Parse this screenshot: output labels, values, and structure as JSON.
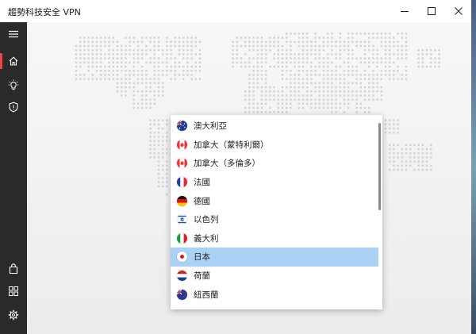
{
  "window": {
    "title": "趨勢科技安全 VPN",
    "controls": [
      "minimize",
      "maximize",
      "close"
    ]
  },
  "sidebar": {
    "top": [
      {
        "name": "menu",
        "icon": "hamburger-menu-icon"
      },
      {
        "name": "home",
        "icon": "home-icon",
        "active": true
      },
      {
        "name": "tips",
        "icon": "lightbulb-icon"
      },
      {
        "name": "security",
        "icon": "shield-icon"
      }
    ],
    "bottom": [
      {
        "name": "shop",
        "icon": "shopping-bag-icon"
      },
      {
        "name": "apps",
        "icon": "apps-grid-icon"
      },
      {
        "name": "settings",
        "icon": "gear-icon"
      }
    ],
    "accent_color": "#e94848"
  },
  "location_dropdown": {
    "selected": "日本",
    "highlight_color": "#a9d2f5",
    "items": [
      {
        "label": "澳大利亞",
        "flag": "australia"
      },
      {
        "label": "加拿大（蒙特利爾）",
        "flag": "canada"
      },
      {
        "label": "加拿大（多倫多）",
        "flag": "canada"
      },
      {
        "label": "法國",
        "flag": "france"
      },
      {
        "label": "德國",
        "flag": "germany"
      },
      {
        "label": "以色列",
        "flag": "israel"
      },
      {
        "label": "義大利",
        "flag": "italy"
      },
      {
        "label": "日本",
        "flag": "japan"
      },
      {
        "label": "荷蘭",
        "flag": "netherlands"
      },
      {
        "label": "紐西蘭",
        "flag": "new-zealand"
      }
    ]
  }
}
